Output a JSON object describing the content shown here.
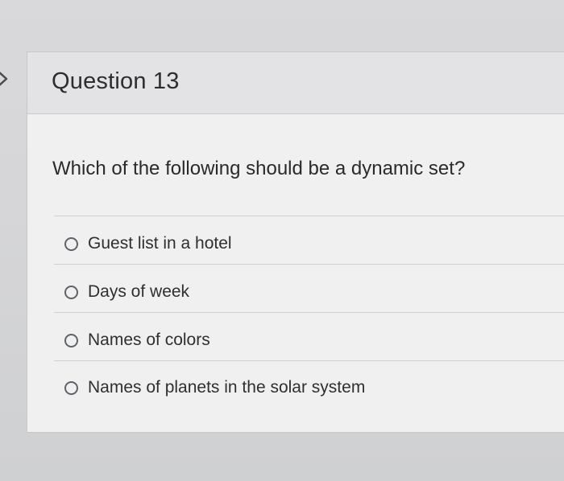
{
  "question": {
    "title": "Question 13",
    "prompt": "Which of the following should be a dynamic set?",
    "options": [
      {
        "label": "Guest list in a hotel"
      },
      {
        "label": "Days of week"
      },
      {
        "label": "Names of colors"
      },
      {
        "label": "Names of planets in the solar system"
      }
    ]
  },
  "icons": {
    "edge": "chevron-right-icon",
    "option": "radio-unselected-icon"
  },
  "colors": {
    "background": "#d6d6d8",
    "card": "#f0f0f1",
    "header": "#e3e3e5",
    "text": "#2d2d2f"
  }
}
